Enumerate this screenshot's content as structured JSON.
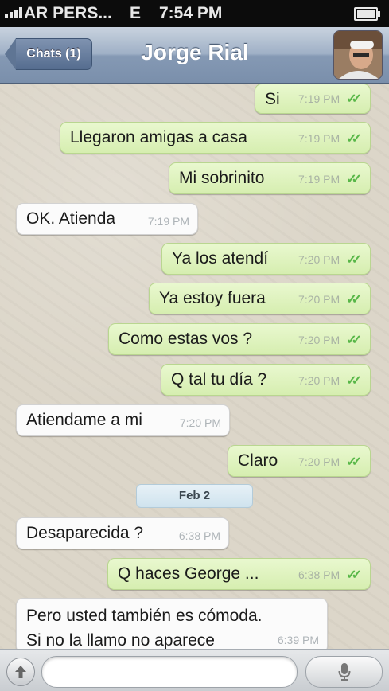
{
  "status_bar": {
    "carrier": "AR PERS...",
    "network": "E",
    "time": "7:54 PM"
  },
  "nav": {
    "back_label": "Chats (1)",
    "title": "Jorge Rial"
  },
  "messages": [
    {
      "dir": "out",
      "text": "Si",
      "time": "7:19 PM"
    },
    {
      "dir": "out",
      "text": "Llegaron amigas a casa",
      "time": "7:19 PM"
    },
    {
      "dir": "out",
      "text": "Mi sobrinito",
      "time": "7:19 PM"
    },
    {
      "dir": "in",
      "text": "OK. Atienda",
      "time": "7:19 PM"
    },
    {
      "dir": "out",
      "text": "Ya los atendí",
      "time": "7:20 PM"
    },
    {
      "dir": "out",
      "text": "Ya estoy fuera",
      "time": "7:20 PM"
    },
    {
      "dir": "out",
      "text": "Como estas vos ?",
      "time": "7:20 PM"
    },
    {
      "dir": "out",
      "text": "Q tal tu día ?",
      "time": "7:20 PM"
    },
    {
      "dir": "in",
      "text": "Atiendame a mi",
      "time": "7:20 PM"
    },
    {
      "dir": "out",
      "text": "Claro",
      "time": "7:20 PM"
    },
    {
      "dir": "in",
      "text": "Desaparecida ?",
      "time": "6:38 PM"
    },
    {
      "dir": "out",
      "text": "Q haces George ...",
      "time": "6:38 PM"
    },
    {
      "dir": "in",
      "text_line1": "Pero usted también es cómoda.",
      "text_line2": "Si no la llamo no aparece",
      "time": "6:39 PM"
    }
  ],
  "day_separator": "Feb 2",
  "input": {
    "attach_icon": "arrow-up-icon",
    "mic_icon": "microphone-icon"
  },
  "colors": {
    "outgoing_bubble": "#dcf2bd",
    "incoming_bubble": "#fbfbfb",
    "read_ticks": "#58b748"
  }
}
